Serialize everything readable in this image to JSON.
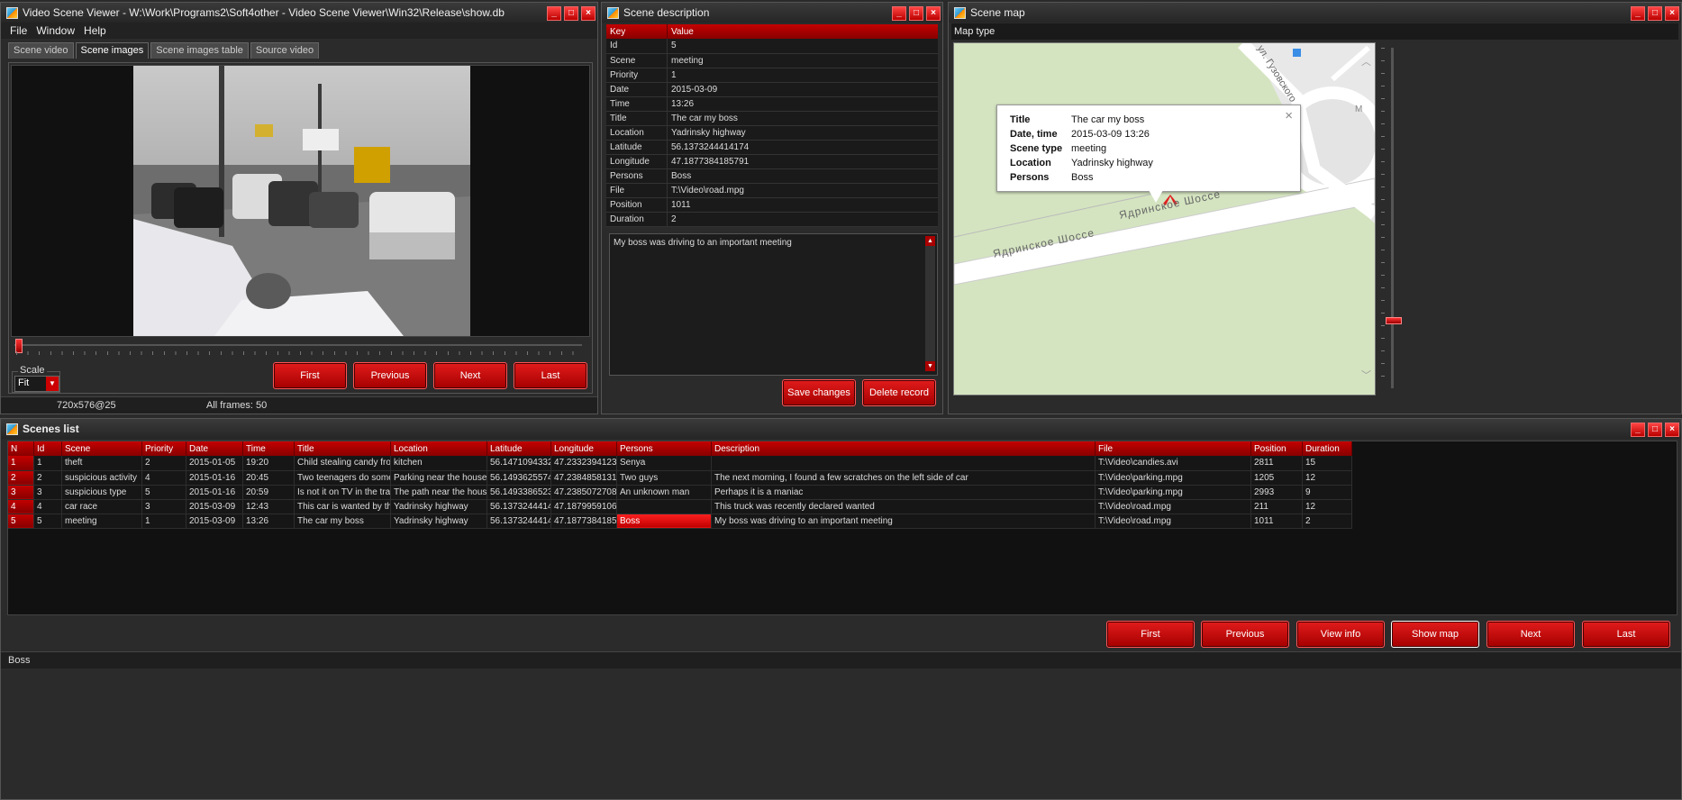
{
  "video_window": {
    "title": "Video Scene Viewer - W:\\Work\\Programs2\\Soft4other - Video Scene Viewer\\Win32\\Release\\show.db",
    "menu": [
      "File",
      "Window",
      "Help"
    ],
    "tabs": [
      "Scene video",
      "Scene images",
      "Scene images table",
      "Source video"
    ],
    "active_tab": "Scene images",
    "scale_label": "Scale",
    "scale_value": "Fit",
    "buttons": {
      "first": "First",
      "previous": "Previous",
      "next": "Next",
      "last": "Last"
    },
    "status_resolution": "720x576@25",
    "status_frames": "All frames: 50"
  },
  "desc_window": {
    "title": "Scene description",
    "headers": {
      "key": "Key",
      "value": "Value"
    },
    "rows": [
      {
        "key": "Id",
        "value": "5"
      },
      {
        "key": "Scene",
        "value": "meeting"
      },
      {
        "key": "Priority",
        "value": "1"
      },
      {
        "key": "Date",
        "value": "2015-03-09"
      },
      {
        "key": "Time",
        "value": "13:26"
      },
      {
        "key": "Title",
        "value": "The car my boss"
      },
      {
        "key": "Location",
        "value": "Yadrinsky highway"
      },
      {
        "key": "Latitude",
        "value": "56.1373244414174"
      },
      {
        "key": "Longitude",
        "value": "47.1877384185791"
      },
      {
        "key": "Persons",
        "value": "Boss"
      },
      {
        "key": "File",
        "value": "T:\\Video\\road.mpg"
      },
      {
        "key": "Position",
        "value": "1011"
      },
      {
        "key": "Duration",
        "value": "2"
      }
    ],
    "description_text": "My boss was driving to an important meeting",
    "buttons": {
      "save": "Save changes",
      "delete": "Delete record"
    }
  },
  "map_window": {
    "title": "Scene map",
    "map_type_label": "Map type",
    "road_label": "Ядринское Шоссе",
    "road_label_2": "Ядринское Шоссе",
    "street_label": "ул. Гузовского",
    "popup": [
      {
        "label": "Title",
        "value": "The car my boss"
      },
      {
        "label": "Date, time",
        "value": "2015-03-09 13:26"
      },
      {
        "label": "Scene type",
        "value": "meeting"
      },
      {
        "label": "Location",
        "value": "Yadrinsky highway"
      },
      {
        "label": "Persons",
        "value": "Boss"
      }
    ],
    "popup_close": "×",
    "edge_letter": "М"
  },
  "scenes_window": {
    "title": "Scenes list",
    "columns": [
      "N",
      "Id",
      "Scene",
      "Priority",
      "Date",
      "Time",
      "Title",
      "Location",
      "Latitude",
      "Longitude",
      "Persons",
      "Description",
      "File",
      "Position",
      "Duration"
    ],
    "rows": [
      [
        "1",
        "1",
        "theft",
        "2",
        "2015-01-05",
        "19:20",
        "Child stealing candy fror",
        "kitchen",
        "56.1471094332",
        "47.2332394123",
        "Senya",
        "",
        "T:\\Video\\candies.avi",
        "2811",
        "15"
      ],
      [
        "2",
        "2",
        "suspicious activity",
        "4",
        "2015-01-16",
        "20:45",
        "Two teenagers do some",
        "Parking near the house",
        "56.1493625574",
        "47.2384858131",
        "Two guys",
        "The next morning, I found a few scratches on the left side of car",
        "T:\\Video\\parking.mpg",
        "1205",
        "12"
      ],
      [
        "3",
        "3",
        "suspicious type",
        "5",
        "2015-01-16",
        "20:59",
        "Is not it on TV in the tra",
        "The path near the hous",
        "56.1493386523",
        "47.2385072708",
        "An unknown man",
        "Perhaps it is a maniac",
        "T:\\Video\\parking.mpg",
        "2993",
        "9"
      ],
      [
        "4",
        "4",
        "car race",
        "3",
        "2015-03-09",
        "12:43",
        "This car is wanted by th",
        "Yadrinsky highway",
        "56.1373244414",
        "47.1879959106",
        "",
        "This truck was recently declared wanted",
        "T:\\Video\\road.mpg",
        "211",
        "12"
      ],
      [
        "5",
        "5",
        "meeting",
        "1",
        "2015-03-09",
        "13:26",
        "The car my boss",
        "Yadrinsky highway",
        "56.1373244414",
        "47.1877384185",
        "Boss",
        "My boss was driving to an important meeting",
        "T:\\Video\\road.mpg",
        "1011",
        "2"
      ]
    ],
    "selected_row": 5,
    "selected_col": "Persons",
    "buttons": {
      "first": "First",
      "previous": "Previous",
      "view_info": "View info",
      "show_map": "Show map",
      "next": "Next",
      "last": "Last"
    },
    "status_text": "Boss"
  },
  "colors": {
    "accent": "#cc0000",
    "map_bg": "#d4e4c0",
    "road": "#ffffff"
  }
}
